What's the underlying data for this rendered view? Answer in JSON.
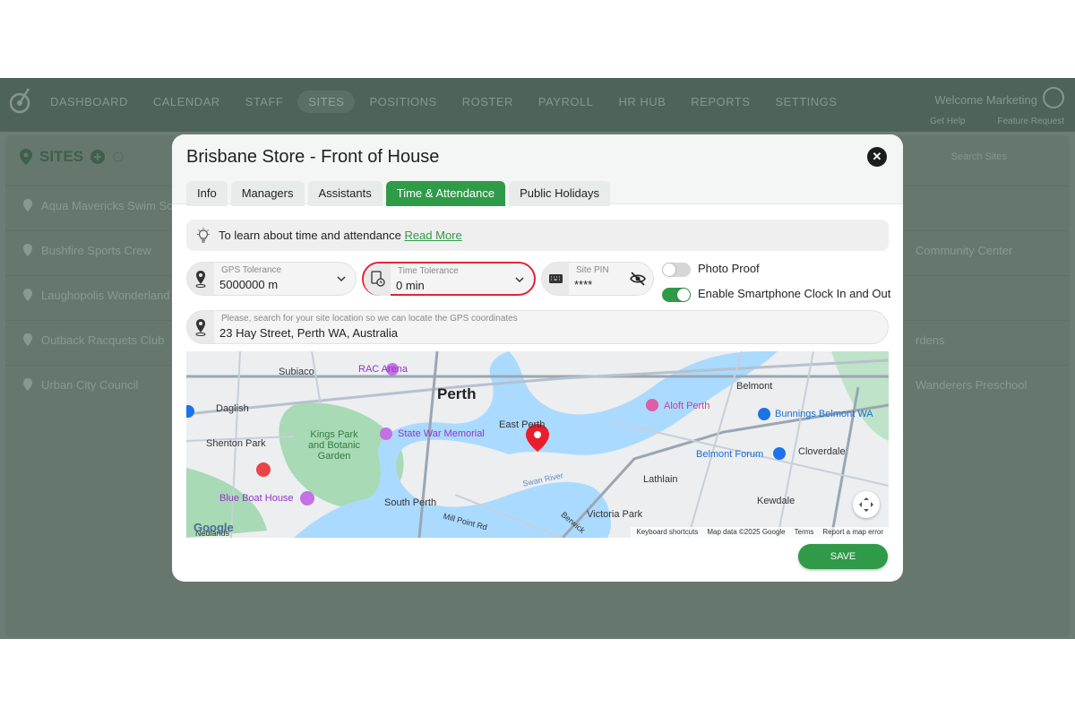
{
  "nav": {
    "items": [
      {
        "label": "DASHBOARD"
      },
      {
        "label": "CALENDAR"
      },
      {
        "label": "STAFF"
      },
      {
        "label": "SITES",
        "active": true
      },
      {
        "label": "POSITIONS"
      },
      {
        "label": "ROSTER"
      },
      {
        "label": "PAYROLL"
      },
      {
        "label": "HR HUB"
      },
      {
        "label": "REPORTS"
      },
      {
        "label": "SETTINGS"
      }
    ],
    "welcome": "Welcome Marketing",
    "get_help": "Get Help",
    "feature_request": "Feature Request"
  },
  "sites": {
    "title": "SITES",
    "search_placeholder": "Search Sites",
    "rows": [
      {
        "left": "Aqua Mavericks Swim Sch",
        "right": ""
      },
      {
        "left": "Bushfire Sports Crew",
        "right": "Community Center"
      },
      {
        "left": "Laughopolis Wonderland",
        "right": ""
      },
      {
        "left": "Outback Racquets Club",
        "right": "rdens"
      },
      {
        "left": "Urban City Council",
        "right": "Wanderers Preschool"
      }
    ]
  },
  "modal": {
    "title": "Brisbane Store - Front of House",
    "tabs": [
      {
        "label": "Info"
      },
      {
        "label": "Managers"
      },
      {
        "label": "Assistants"
      },
      {
        "label": "Time & Attendance",
        "active": true
      },
      {
        "label": "Public Holidays"
      }
    ],
    "info_text": "To learn about time and attendance",
    "info_link": "Read More",
    "gps_tolerance": {
      "label": "GPS Tolerance",
      "value": "5000000 m"
    },
    "time_tolerance": {
      "label": "Time Tolerance",
      "value": "0 min"
    },
    "site_pin": {
      "label": "Site PIN",
      "value": "****"
    },
    "photo_proof": {
      "label": "Photo Proof",
      "on": false
    },
    "smartphone_clock": {
      "label": "Enable Smartphone Clock In and Out",
      "on": true
    },
    "location": {
      "label": "Please, search for your site location so we can locate the GPS coordinates",
      "value": "23 Hay Street, Perth WA, Australia"
    },
    "map": {
      "labels": {
        "perth": "Perth",
        "subiaco": "Subiaco",
        "rac_arena": "RAC Arena",
        "daglish": "Daglish",
        "shenton_park": "Shenton Park",
        "kings_park": "Kings Park and Botanic Garden",
        "state_war_memorial": "State War Memorial",
        "east_perth": "East Perth",
        "aloft_perth": "Aloft Perth",
        "belmont": "Belmont",
        "bunnings": "Bunnings Belmont WA",
        "belmont_forum": "Belmont Forum",
        "cloverdale": "Cloverdale",
        "lathlain": "Lathlain",
        "kewdale": "Kewdale",
        "victoria_park": "Victoria Park",
        "south_perth": "South Perth",
        "blue_boat_house": "Blue Boat House",
        "swan_river": "Swan River",
        "mill_point": "Mill Point Rd",
        "nedlands": "Nedlands",
        "berwick": "Berwick"
      },
      "footer": {
        "shortcuts": "Keyboard shortcuts",
        "map_data": "Map data ©2025 Google",
        "terms": "Terms",
        "report": "Report a map error"
      },
      "google": "Google"
    },
    "save_label": "SAVE"
  },
  "colors": {
    "accent": "#2f9a48",
    "highlight": "#e0253b"
  }
}
